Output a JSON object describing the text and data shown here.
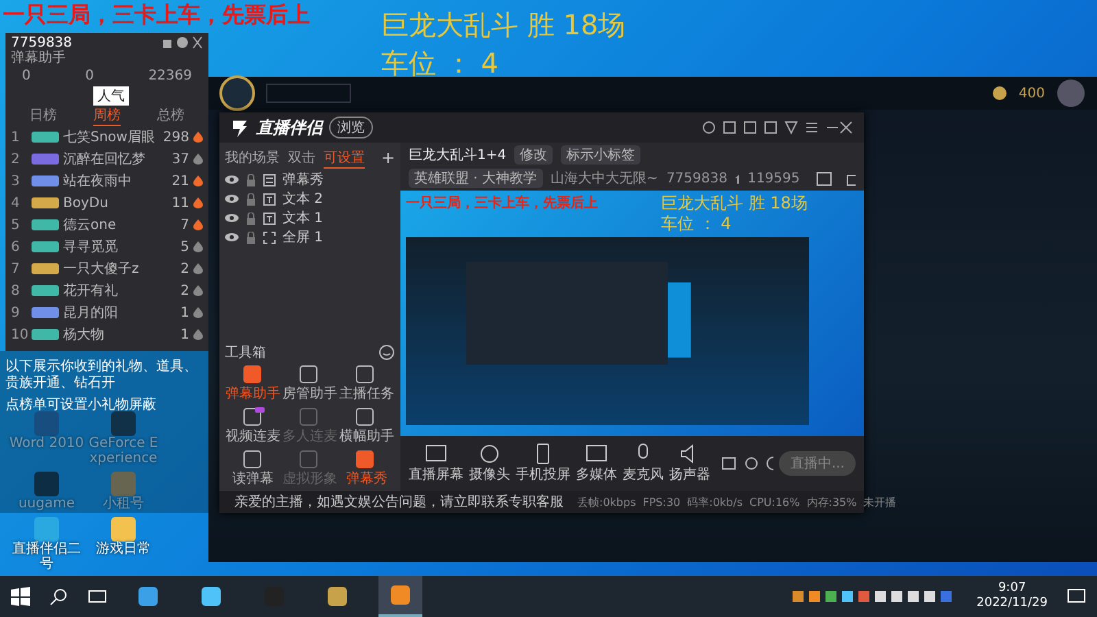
{
  "overlay": {
    "promo": "一只三局，三卡上车，先票后上",
    "title": "巨龙大乱斗 胜 18场",
    "seat": "车位 ： 4"
  },
  "desktop_icons": [
    {
      "label": "Word 2010",
      "kind": "word"
    },
    {
      "label": "GeForce Experience",
      "kind": "nvidia"
    },
    {
      "label": "uugame",
      "kind": "uu"
    },
    {
      "label": "小租号",
      "kind": "rent"
    },
    {
      "label": "直播伴侣二号",
      "kind": "bird"
    },
    {
      "label": "游戏日常",
      "kind": "folder"
    }
  ],
  "gift_panel": {
    "room_id": "7759838",
    "title": "弹幕助手",
    "stats": [
      "0",
      "0",
      "22369"
    ],
    "tooltip": "人气",
    "tabs": [
      {
        "label": "日榜",
        "selected": false
      },
      {
        "label": "周榜",
        "selected": true
      },
      {
        "label": "总榜",
        "selected": false
      }
    ],
    "rows": [
      {
        "rank": "1",
        "name": "七笑Snow眉眼",
        "count": "298",
        "color": "#3fb8a8",
        "flame": true
      },
      {
        "rank": "2",
        "name": "沉醉在回忆梦",
        "count": "37",
        "color": "#7a6be0",
        "flame": false
      },
      {
        "rank": "3",
        "name": "站在夜雨中",
        "count": "21",
        "color": "#6f8fe8",
        "flame": true
      },
      {
        "rank": "4",
        "name": "BoyDu",
        "count": "11",
        "color": "#d4a94a",
        "flame": true
      },
      {
        "rank": "5",
        "name": "德云one",
        "count": "7",
        "color": "#3fb8a8",
        "flame": true
      },
      {
        "rank": "6",
        "name": "寻寻觅觅",
        "count": "5",
        "color": "#3fb8a8",
        "flame": false
      },
      {
        "rank": "7",
        "name": "一只大傻子z",
        "count": "2",
        "color": "#d4a94a",
        "flame": false
      },
      {
        "rank": "8",
        "name": "花开有礼",
        "count": "2",
        "color": "#3fb8a8",
        "flame": false
      },
      {
        "rank": "9",
        "name": "昆月的阳",
        "count": "1",
        "color": "#6f8fe8",
        "flame": false
      },
      {
        "rank": "10",
        "name": "杨大物",
        "count": "1",
        "color": "#3fb8a8",
        "flame": false
      }
    ],
    "notes": [
      "以下展示你收到的礼物、道具、贵族开通、钻石开",
      "点榜单可设置小礼物屏蔽"
    ]
  },
  "game_client": {
    "coins": "400"
  },
  "app": {
    "logo": "直播伴侣",
    "version_tag": "浏览",
    "scene_tabs": [
      {
        "label": "我的场景",
        "selected": false
      },
      {
        "label": "双击",
        "selected": false
      },
      {
        "label": "可设置",
        "selected": true
      }
    ],
    "sources": [
      {
        "name": "弹幕秀",
        "kind": "list"
      },
      {
        "name": "文本 2",
        "kind": "text"
      },
      {
        "name": "文本 1",
        "kind": "text"
      },
      {
        "name": "全屏 1",
        "kind": "screen"
      }
    ],
    "add_label": "+",
    "toolbox_title": "工具箱",
    "tools": [
      {
        "label": "弹幕助手",
        "highlight": true,
        "disabled": false,
        "new_badge": false
      },
      {
        "label": "房管助手",
        "highlight": false,
        "disabled": false,
        "new_badge": false
      },
      {
        "label": "主播任务",
        "highlight": false,
        "disabled": false,
        "new_badge": false
      },
      {
        "label": "视频连麦",
        "highlight": false,
        "disabled": false,
        "new_badge": true
      },
      {
        "label": "多人连麦",
        "highlight": false,
        "disabled": true,
        "new_badge": false
      },
      {
        "label": "横幅助手",
        "highlight": false,
        "disabled": false,
        "new_badge": false
      },
      {
        "label": "读弹幕",
        "highlight": false,
        "disabled": false,
        "new_badge": false
      },
      {
        "label": "虚拟形象",
        "highlight": false,
        "disabled": true,
        "new_badge": false
      },
      {
        "label": "弹幕秀",
        "highlight": true,
        "disabled": false,
        "new_badge": false
      }
    ],
    "stream": {
      "title": "巨龙大乱斗1+4",
      "edit_tag": "修改",
      "label_tag": "标示小标签",
      "category": "英雄联盟 · 大神教学",
      "room_name": "山海大中大无限~",
      "room_id": "7759838",
      "viewers": "119595"
    },
    "preview": {
      "promo": "一只三局，三卡上车，先票后上",
      "title": "巨龙大乱斗 胜 18场",
      "seat": "车位 ： 4"
    },
    "controls": [
      {
        "label": "直播屏幕",
        "kind": "screen"
      },
      {
        "label": "摄像头",
        "kind": "camera"
      },
      {
        "label": "手机投屏",
        "kind": "phone"
      },
      {
        "label": "多媒体",
        "kind": "media"
      },
      {
        "label": "麦克风",
        "kind": "mic"
      },
      {
        "label": "扬声器",
        "kind": "speaker"
      }
    ],
    "live_button": "直播中...",
    "notice": "亲爱的主播，如遇文娱公告问题，请立即联系专职客服",
    "stats": [
      "丢帧:0kbps",
      "FPS:30",
      "码率:0kb/s",
      "CPU:16%",
      "内存:35%",
      "未开播"
    ]
  },
  "taskbar": {
    "apps": [
      {
        "kind": "ie",
        "selected": false
      },
      {
        "kind": "bird",
        "selected": false
      },
      {
        "kind": "g",
        "selected": false
      },
      {
        "kind": "lol",
        "selected": false
      },
      {
        "kind": "live",
        "selected": true
      }
    ],
    "time": "9:07",
    "date": "2022/11/29"
  }
}
